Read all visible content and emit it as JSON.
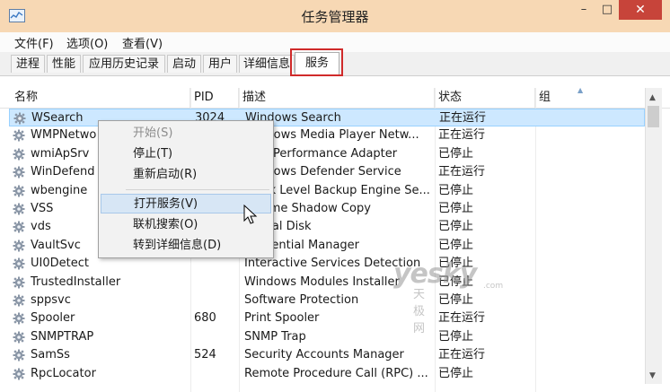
{
  "window": {
    "title": "任务管理器",
    "minimize_glyph": "–",
    "maximize_glyph": "□",
    "close_glyph": "✕"
  },
  "menu": [
    "文件(F)",
    "选项(O)",
    "查看(V)"
  ],
  "tabs": [
    {
      "label": "进程",
      "active": false
    },
    {
      "label": "性能",
      "active": false
    },
    {
      "label": "应用历史记录",
      "active": false
    },
    {
      "label": "启动",
      "active": false
    },
    {
      "label": "用户",
      "active": false
    },
    {
      "label": "详细信息",
      "active": false
    },
    {
      "label": "服务",
      "active": true
    }
  ],
  "columns": {
    "name": "名称",
    "pid": "PID",
    "desc": "描述",
    "status": "状态",
    "group": "组"
  },
  "services": [
    {
      "name": "WSearch",
      "pid": "3024",
      "desc": "Windows Search",
      "status": "正在运行",
      "selected": true
    },
    {
      "name": "WMPNetwo",
      "pid": "",
      "desc": "Windows Media Player Netw...",
      "status": "正在运行"
    },
    {
      "name": "wmiApSrv",
      "pid": "",
      "desc": "WMI Performance Adapter",
      "status": "已停止"
    },
    {
      "name": "WinDefend",
      "pid": "",
      "desc": "Windows Defender Service",
      "status": "正在运行"
    },
    {
      "name": "wbengine",
      "pid": "",
      "desc": "Block Level Backup Engine Se...",
      "status": "已停止"
    },
    {
      "name": "VSS",
      "pid": "",
      "desc": "Volume Shadow Copy",
      "status": "已停止"
    },
    {
      "name": "vds",
      "pid": "",
      "desc": "Virtual Disk",
      "status": "已停止"
    },
    {
      "name": "VaultSvc",
      "pid": "",
      "desc": "Credential Manager",
      "status": "已停止"
    },
    {
      "name": "UI0Detect",
      "pid": "",
      "desc": "Interactive Services Detection",
      "status": "已停止"
    },
    {
      "name": "TrustedInstaller",
      "pid": "",
      "desc": "Windows Modules Installer",
      "status": "已停止"
    },
    {
      "name": "sppsvc",
      "pid": "",
      "desc": "Software Protection",
      "status": "已停止"
    },
    {
      "name": "Spooler",
      "pid": "680",
      "desc": "Print Spooler",
      "status": "正在运行"
    },
    {
      "name": "SNMPTRAP",
      "pid": "",
      "desc": "SNMP Trap",
      "status": "已停止"
    },
    {
      "name": "SamSs",
      "pid": "524",
      "desc": "Security Accounts Manager",
      "status": "正在运行"
    },
    {
      "name": "RpcLocator",
      "pid": "",
      "desc": "Remote Procedure Call (RPC) ...",
      "status": "已停止"
    }
  ],
  "context_menu": {
    "start": "开始(S)",
    "stop": "停止(T)",
    "restart": "重新启动(R)",
    "open_services": "打开服务(V)",
    "search_online": "联机搜索(O)",
    "goto_details": "转到详细信息(D)"
  },
  "watermark": {
    "brand": "yesky",
    "cn": "天极网",
    "domain": ".com"
  },
  "colors": {
    "titlebar": "#f7d8b4",
    "close": "#c7443a",
    "selection": "#cde8ff",
    "highlight_border": "#d02a2a"
  }
}
